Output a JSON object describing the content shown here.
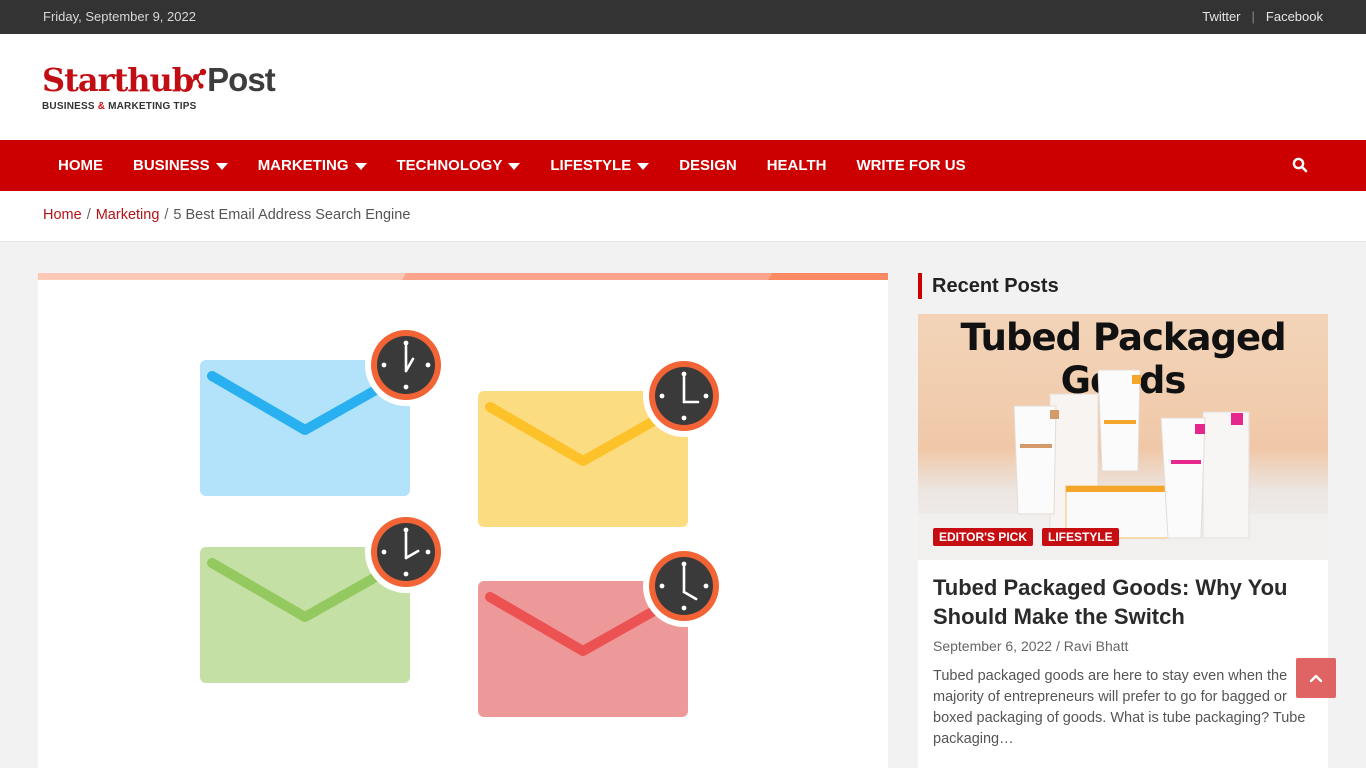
{
  "topbar": {
    "date": "Friday, September 9, 2022",
    "social_links": [
      {
        "label": "Twitter"
      },
      {
        "label": "Facebook"
      }
    ],
    "separator": "|"
  },
  "logo": {
    "name_part1": "Starthub",
    "name_part2": "Post",
    "tagline_part1": "BUSINESS ",
    "tagline_amp": "&",
    "tagline_part2": " MARKETING TIPS",
    "brand_red": "#c10e14"
  },
  "nav": {
    "items": [
      {
        "label": "HOME",
        "has_dropdown": false
      },
      {
        "label": "BUSINESS",
        "has_dropdown": true
      },
      {
        "label": "MARKETING",
        "has_dropdown": true
      },
      {
        "label": "TECHNOLOGY",
        "has_dropdown": true
      },
      {
        "label": "LIFESTYLE",
        "has_dropdown": true
      },
      {
        "label": "DESIGN",
        "has_dropdown": false
      },
      {
        "label": "HEALTH",
        "has_dropdown": false
      },
      {
        "label": "WRITE FOR US",
        "has_dropdown": false
      }
    ],
    "search_icon": "search-icon",
    "bar_color": "#cc0000"
  },
  "breadcrumb": {
    "items": [
      {
        "label": "Home",
        "link": true
      },
      {
        "label": "Marketing",
        "link": true
      },
      {
        "label": "5 Best Email Address Search Engine",
        "link": false
      }
    ],
    "separator": "/"
  },
  "article": {
    "featured_image_alt": "Four colored envelopes with clock badges",
    "envelopes": [
      {
        "color": "blue",
        "fill": "#b3e3fb",
        "stroke": "#29b0f0",
        "clock_hour": 1
      },
      {
        "color": "yellow",
        "fill": "#fcdc80",
        "stroke": "#fdc22a",
        "clock_hour": 3
      },
      {
        "color": "green",
        "fill": "#c5e0a5",
        "stroke": "#93c95e",
        "clock_hour": 2
      },
      {
        "color": "red",
        "fill": "#ee9999",
        "stroke": "#ec5252",
        "clock_hour": 4
      }
    ]
  },
  "sidebar": {
    "widget_title": "Recent Posts",
    "posts": [
      {
        "thumb_text": "Tubed Packaged Goods",
        "badges": [
          "EDITOR'S PICK",
          "LIFESTYLE"
        ],
        "title": "Tubed Packaged Goods: Why You Should Make the Switch",
        "date": "September 6, 2022",
        "meta_sep": "/",
        "author": "Ravi Bhatt",
        "excerpt": "Tubed packaged goods are here to stay even when the majority of entrepreneurs will prefer to go for bagged or boxed packaging of goods. What is tube packaging? Tube packaging…"
      }
    ]
  },
  "scroll_top": {
    "icon": "chevron-up-icon"
  }
}
